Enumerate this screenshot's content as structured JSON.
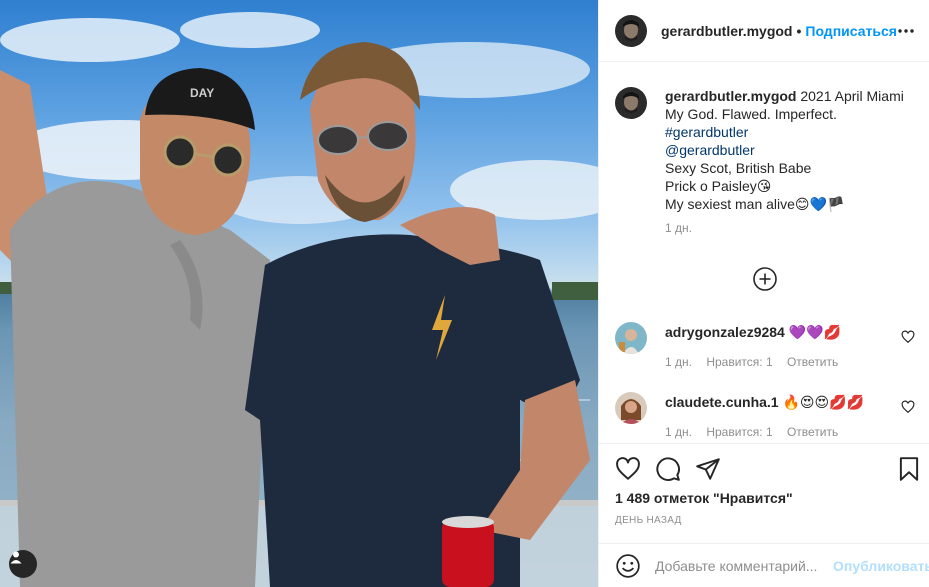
{
  "post": {
    "username": "gerardbutler.mygod",
    "separator": "•",
    "follow_label": "Подписаться",
    "caption": {
      "username": "gerardbutler.mygod",
      "first_line": "2021 April Miami",
      "line2": "My God. Flawed. Imperfect.",
      "hashtag": "#gerardbutler",
      "mention": "@gerardbutler",
      "line5": "Sexy Scot, British Babe",
      "line6": "Prick o Paisley😘",
      "line7": "My sexiest man alive😊💙🏴"
    },
    "caption_time": "1 дн."
  },
  "comments": [
    {
      "username": "adrygonzalez9284",
      "text": "💜💜💋",
      "time": "1 дн.",
      "likes": "Нравится: 1",
      "reply": "Ответить"
    },
    {
      "username": "claudete.cunha.1",
      "text": "🔥😍😍💋💋",
      "time": "1 дн.",
      "likes": "Нравится: 1",
      "reply": "Ответить"
    }
  ],
  "actions": {
    "likes_text": "1 489 отметок \"Нравится\"",
    "posted_text": "ДЕНЬ НАЗАД"
  },
  "comment_box": {
    "placeholder": "Добавьте комментарий...",
    "publish_label": "Опубликовать"
  },
  "colors": {
    "accent": "#0095f6",
    "publish_disabled": "#b2dffc",
    "muted": "#8e8e8e",
    "link": "#00376b"
  }
}
